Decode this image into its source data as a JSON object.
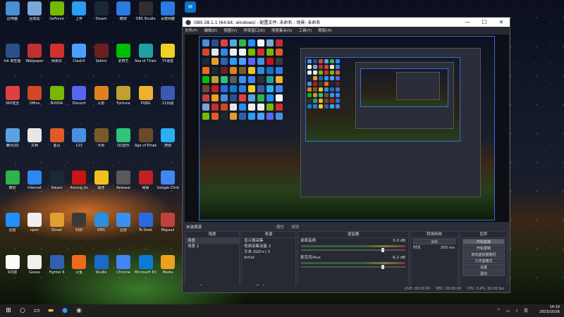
{
  "desktop": {
    "icons": [
      {
        "label": "此电脑",
        "color": "#4a8fd6"
      },
      {
        "label": "Ink 高性能",
        "color": "#2b4f88"
      },
      {
        "label": "360安全",
        "color": "#e04040"
      },
      {
        "label": "腾讯QQ",
        "color": "#5aa3e0"
      },
      {
        "label": "微信",
        "color": "#31b34a"
      },
      {
        "label": "迅雷",
        "color": "#1e90ff"
      },
      {
        "label": "X内容",
        "color": "#fafafa"
      },
      {
        "label": "回收站",
        "color": "#7aa8d8"
      },
      {
        "label": "Wallpaper",
        "color": "#c03030"
      },
      {
        "label": "Office",
        "color": "#d24726"
      },
      {
        "label": "文档",
        "color": "#e7e7e7"
      },
      {
        "label": "Internet",
        "color": "#2d89ef"
      },
      {
        "label": "open",
        "color": "#efefef"
      },
      {
        "label": "Goose",
        "color": "#f0f0f0"
      },
      {
        "label": "GeForce",
        "color": "#76b900"
      },
      {
        "label": "网易云",
        "color": "#d32f2f"
      },
      {
        "label": "NVIDIA",
        "color": "#76b900"
      },
      {
        "label": "金山",
        "color": "#e05a2a"
      },
      {
        "label": "Steam",
        "color": "#1b2838"
      },
      {
        "label": "Street",
        "color": "#e0a030"
      },
      {
        "label": "Fighter 6",
        "color": "#3060b0"
      },
      {
        "label": "上传",
        "color": "#2a9df4"
      },
      {
        "label": "ClashX",
        "color": "#4aa0ff"
      },
      {
        "label": "Discord",
        "color": "#5865f2"
      },
      {
        "label": "123",
        "color": "#4a90e2"
      },
      {
        "label": "Among Us",
        "color": "#c81414"
      },
      {
        "label": "利剑",
        "color": "#3a3a3a"
      },
      {
        "label": "火鱼",
        "color": "#f06a1a"
      },
      {
        "label": "Steam",
        "color": "#1b2838"
      },
      {
        "label": "Sekiro",
        "color": "#6a2020"
      },
      {
        "label": "火影",
        "color": "#e08020"
      },
      {
        "label": "大师",
        "color": "#7a5a2a"
      },
      {
        "label": "最佳",
        "color": "#f0c020"
      },
      {
        "label": "KMS",
        "color": "#2a8fe0"
      },
      {
        "label": "Studio",
        "color": "#1a6ac8"
      },
      {
        "label": "酷狗",
        "color": "#2a7ae0"
      },
      {
        "label": "爱奇艺",
        "color": "#00be06"
      },
      {
        "label": "Fortune",
        "color": "#c0a030"
      },
      {
        "label": "QQ音乐",
        "color": "#31c27c"
      },
      {
        "label": "Release",
        "color": "#5a5a5a"
      },
      {
        "label": "迅雷",
        "color": "#3a90f0"
      },
      {
        "label": "Chrome",
        "color": "#4285f4"
      },
      {
        "label": "OBS Studio",
        "color": "#302e31"
      },
      {
        "label": "Sea of Thieves",
        "color": "#20a0a0"
      },
      {
        "label": "PUBG",
        "color": "#f0b030"
      },
      {
        "label": "Age of Empires IV",
        "color": "#6a4a2a"
      },
      {
        "label": "网易",
        "color": "#c02020"
      },
      {
        "label": "To Desk",
        "color": "#2a6ae0"
      },
      {
        "label": "Microsoft Edge",
        "color": "#0c7bd6"
      },
      {
        "label": "百度网盘",
        "color": "#2a7ae0"
      },
      {
        "label": "YY语音",
        "color": "#f0d020"
      },
      {
        "label": "11对战",
        "color": "#3a5ab0"
      },
      {
        "label": "搜狗",
        "color": "#2ab0f0"
      },
      {
        "label": "Google Chrome",
        "color": "#4285f4"
      },
      {
        "label": "Majsoul",
        "color": "#c04040"
      },
      {
        "label": "Media",
        "color": "#f0a020"
      }
    ]
  },
  "obs": {
    "title": "OBS 28.1.1 (64-bit, windows) - 配置文件: 未命名 - 场景: 未命名",
    "menu": [
      "文件(F)",
      "编辑(E)",
      "视图(V)",
      "停靠窗口(D)",
      "场景集合(S)",
      "工具(T)",
      "帮助(H)"
    ],
    "window_buttons": {
      "minimize": "—",
      "maximize": "☐",
      "close": "✕"
    },
    "no_source_selected": "未选择源",
    "properties": "属性",
    "filters": "滤镜",
    "docks": {
      "scenes": {
        "header": "场景",
        "items": [
          "场景",
          "场景 2"
        ]
      },
      "sources": {
        "header": "来源",
        "items": [
          "显示器采集",
          "视频采集设备 2",
          "文本 (GDI+) 3",
          "Artist"
        ]
      },
      "mixer": {
        "header": "混音器",
        "channels": [
          {
            "name": "桌面音频",
            "db": "0.0 dB"
          },
          {
            "name": "麦克风/Aux",
            "db": "-6.2 dB"
          }
        ]
      },
      "transitions": {
        "header": "转场特效",
        "type": "淡出",
        "duration_label": "时长",
        "duration_value": "300 ms"
      },
      "controls": {
        "header": "控件",
        "buttons": [
          "开始直播",
          "开始录制",
          "启动虚拟摄像机",
          "工作室模式",
          "设置",
          "退出"
        ]
      }
    },
    "status": {
      "live": "LIVE: 00:00:00",
      "rec": "REC: 00:00:00",
      "cpu": "CPU: 0.4%, 60.00 fps"
    }
  },
  "taskbar": {
    "start_icon": "windows-icon",
    "search_icon": "search-icon",
    "apps": [
      "file-explorer-icon",
      "edge-icon",
      "obs-icon"
    ],
    "time": "14:10",
    "date": "2023/10/26",
    "lang": "英"
  },
  "colors": {
    "obs_bg": "#2b2e38",
    "obs_dock": "#272a33",
    "selection": "#3c6bd8",
    "taskbar": "#1f1f1f"
  }
}
